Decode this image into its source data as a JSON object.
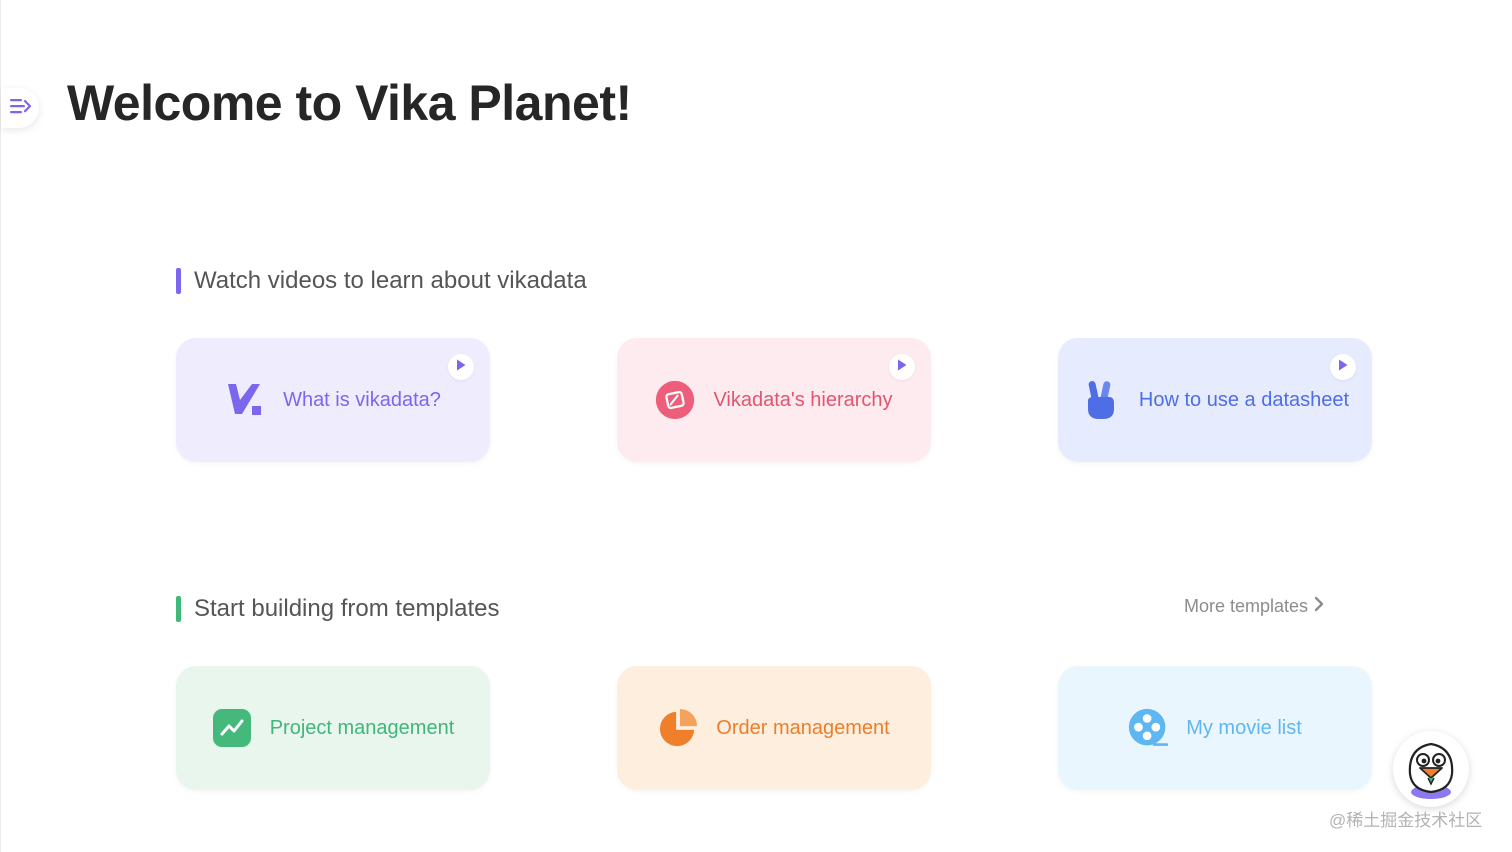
{
  "page": {
    "title": "Welcome to Vika Planet!"
  },
  "videos_section": {
    "title": "Watch videos to learn about vikadata",
    "accent_color": "#7b67ee",
    "cards": [
      {
        "label": "What is vikadata?",
        "icon": "vika-logo-icon",
        "bg": "#efecfd",
        "color": "#7b67ee"
      },
      {
        "label": "Vikadata's hierarchy",
        "icon": "compass-icon",
        "bg": "#fdebef",
        "color": "#e3546e"
      },
      {
        "label": "How to use a datasheet",
        "icon": "peace-hand-icon",
        "bg": "#e6ebfd",
        "color": "#4f6ee6"
      }
    ]
  },
  "templates_section": {
    "title": "Start building from templates",
    "accent_color": "#3fb97a",
    "more_label": "More templates",
    "cards": [
      {
        "label": "Project management",
        "icon": "trend-chart-icon",
        "bg": "#e8f6ee",
        "color": "#40b67a"
      },
      {
        "label": "Order management",
        "icon": "pie-chart-icon",
        "bg": "#fdeedd",
        "color": "#ee7d2a"
      },
      {
        "label": "My movie list",
        "icon": "film-reel-icon",
        "bg": "#eaf6fd",
        "color": "#5fb7f2"
      }
    ]
  },
  "watermark": "@稀土掘金技术社区"
}
